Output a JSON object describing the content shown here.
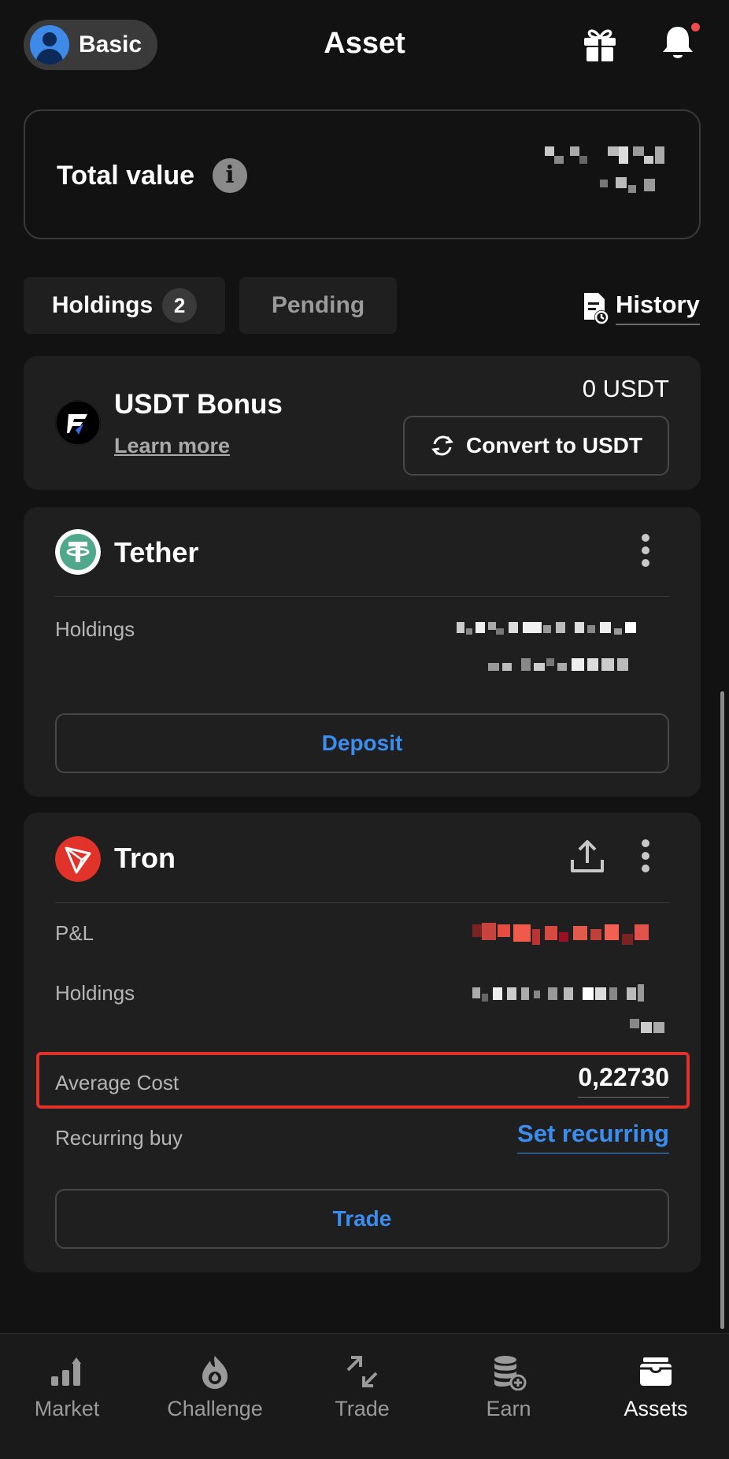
{
  "header": {
    "tier_label": "Basic",
    "title": "Asset"
  },
  "total": {
    "label": "Total value"
  },
  "tabs": {
    "holdings_label": "Holdings",
    "holdings_count": "2",
    "pending_label": "Pending"
  },
  "history": {
    "label": "History"
  },
  "bonus": {
    "name": "USDT Bonus",
    "learn_more": "Learn more",
    "amount": "0 USDT",
    "convert_label": "Convert to USDT"
  },
  "tether": {
    "name": "Tether",
    "holdings_label": "Holdings",
    "deposit_label": "Deposit"
  },
  "tron": {
    "name": "Tron",
    "pnl_label": "P&L",
    "holdings_label": "Holdings",
    "avg_cost_label": "Average Cost",
    "avg_cost_value": "0,22730",
    "recurring_label": "Recurring buy",
    "set_recurring_label": "Set recurring",
    "trade_label": "Trade"
  },
  "nav": {
    "items": [
      {
        "label": "Market",
        "icon": "bar-chart-icon",
        "active": false
      },
      {
        "label": "Challenge",
        "icon": "flame-icon",
        "active": false
      },
      {
        "label": "Trade",
        "icon": "swap-arrows-icon",
        "active": false
      },
      {
        "label": "Earn",
        "icon": "coins-stack-icon",
        "active": false
      },
      {
        "label": "Assets",
        "icon": "wallet-icon",
        "active": true
      }
    ]
  },
  "colors": {
    "background": "#121212",
    "card": "#1f1f1f",
    "accent_blue": "#3b8df0",
    "highlight_red": "#e0312b",
    "tether_green": "#4fa88b",
    "tron_red": "#e2332a"
  }
}
